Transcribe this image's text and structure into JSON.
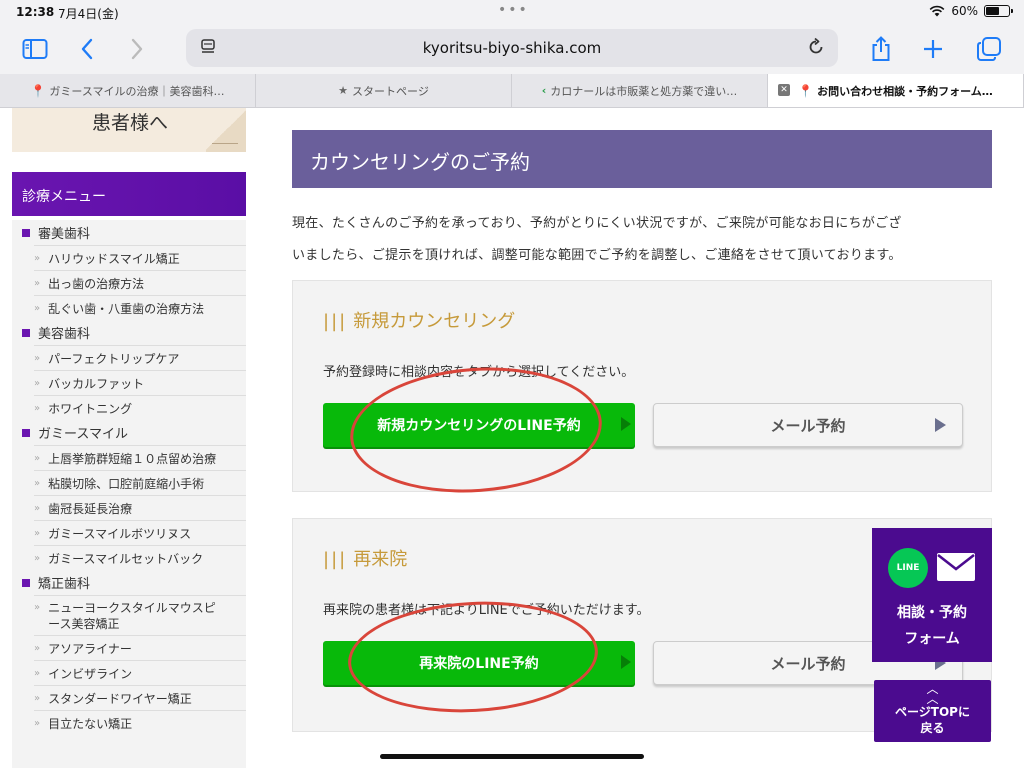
{
  "status": {
    "time": "12:38",
    "date": "7月4日(金)",
    "battery": "60%",
    "battery_level": 0.6
  },
  "browser": {
    "url": "kyoritsu-biyo-shika.com",
    "tabs": [
      {
        "label": "ガミースマイルの治療｜美容歯科…"
      },
      {
        "label": "スタートページ"
      },
      {
        "label": "カロナールは市販薬と処方薬で違い…"
      },
      {
        "label": "お問い合わせ相談・予約フォーム…"
      }
    ]
  },
  "sidebar": {
    "banner": "患者様へ",
    "menu_title": "診療メニュー",
    "categories": [
      {
        "label": "審美歯科",
        "items": [
          "ハリウッドスマイル矯正",
          "出っ歯の治療方法",
          "乱ぐい歯・八重歯の治療方法"
        ]
      },
      {
        "label": "美容歯科",
        "items": [
          "パーフェクトリップケア",
          "バッカルファット",
          "ホワイトニング"
        ]
      },
      {
        "label": "ガミースマイル",
        "items": [
          "上唇挙筋群短縮１０点留め治療",
          "粘膜切除、口腔前庭縮小手術",
          "歯冠長延長治療",
          "ガミースマイルボツリヌス",
          "ガミースマイルセットバック"
        ]
      },
      {
        "label": "矯正歯科",
        "items": [
          "ニューヨークスタイルマウスピース美容矯正",
          "アソアライナー",
          "インビザライン",
          "スタンダードワイヤー矯正",
          "目立たない矯正"
        ]
      }
    ]
  },
  "main": {
    "heading": "カウンセリングのご予約",
    "intro_line1": "現在、たくさんのご予約を承っており、予約がとりにくい状況ですが、ご来院が可能なお日にちがござ",
    "intro_line2": "いましたら、ご提示を頂ければ、調整可能な範囲でご予約を調整し、ご連絡をさせて頂いております。",
    "new": {
      "title": "新規カウンセリング",
      "desc": "予約登録時に相談内容をタブから選択してください。",
      "line_button": "新規カウンセリングのLINE予約",
      "mail_button": "メール予約"
    },
    "revisit": {
      "title": "再来院",
      "desc": "再来院の患者様は下記よりLINEでご予約いただけます。",
      "line_button": "再来院のLINE予約",
      "mail_button": "メール予約"
    }
  },
  "float": {
    "line_icon": "LINE",
    "form_line1": "相談・予約",
    "form_line2": "フォーム",
    "top_line1": "ページTOPに",
    "top_line2": "戻る"
  },
  "colors": {
    "accent_purple": "#6a15b0",
    "header_purple": "#6a5f9b",
    "line_green": "#08b90a",
    "annotation_red": "#d9453a",
    "safari_blue": "#1f7cf7"
  }
}
